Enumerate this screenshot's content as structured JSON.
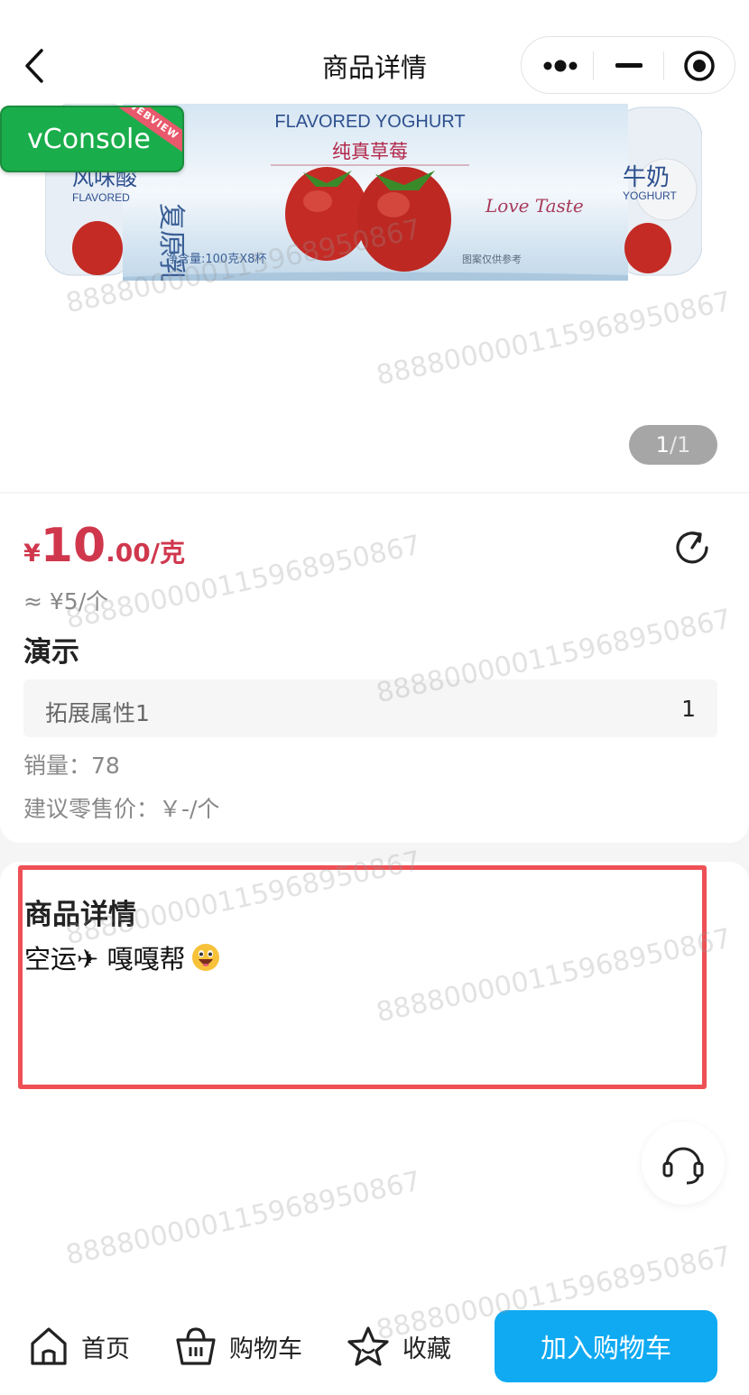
{
  "nav": {
    "title": "商品详情"
  },
  "vconsole": {
    "label": "vConsole",
    "ribbon": "WEBVIEW"
  },
  "gallery": {
    "pager_current": "1",
    "pager_sep_total": "/1",
    "image_texts": {
      "brand": "FLAVORED YOGHURT",
      "flavor": "纯真草莓",
      "left_cn": "风味酸",
      "left_en": "FLAVORED",
      "side_cn": "复原乳",
      "net": "净含量:100克X8杯",
      "right_cn": "牛奶",
      "right_en": "YOGHURT",
      "taste": "Love Taste",
      "ref": "图案仅供参考"
    }
  },
  "product": {
    "price_symbol": "¥",
    "price_int": "10",
    "price_dec": ".00",
    "price_unit": "/克",
    "approx": "≈ ¥5/个",
    "name": "演示",
    "attr_key": "拓展属性1",
    "attr_value": "1",
    "sales": "销量：78",
    "msrp": "建议零售价：￥-/个"
  },
  "detail": {
    "title": "商品详情",
    "text": "空运✈ 嘎嘎帮"
  },
  "bottom": {
    "home": "首页",
    "cart": "购物车",
    "favorite": "收藏",
    "add_cart": "加入购物车"
  },
  "watermark": "8888000001159689508 67",
  "watermark_text": "88880000011596895086 7",
  "watermark_id": "888800000115968950867",
  "colors": {
    "price": "#d0374d",
    "primary_button": "#10aaf2",
    "vconsole": "#1aad4b",
    "highlight_border": "#ee5055"
  },
  "icons": {
    "back": "back-arrow-icon",
    "more": "more-dots-icon",
    "minimize": "minimize-icon",
    "close": "target-close-icon",
    "share": "share-icon",
    "service": "headset-icon",
    "home": "home-icon",
    "cart": "basket-icon",
    "favorite": "star-icon"
  }
}
